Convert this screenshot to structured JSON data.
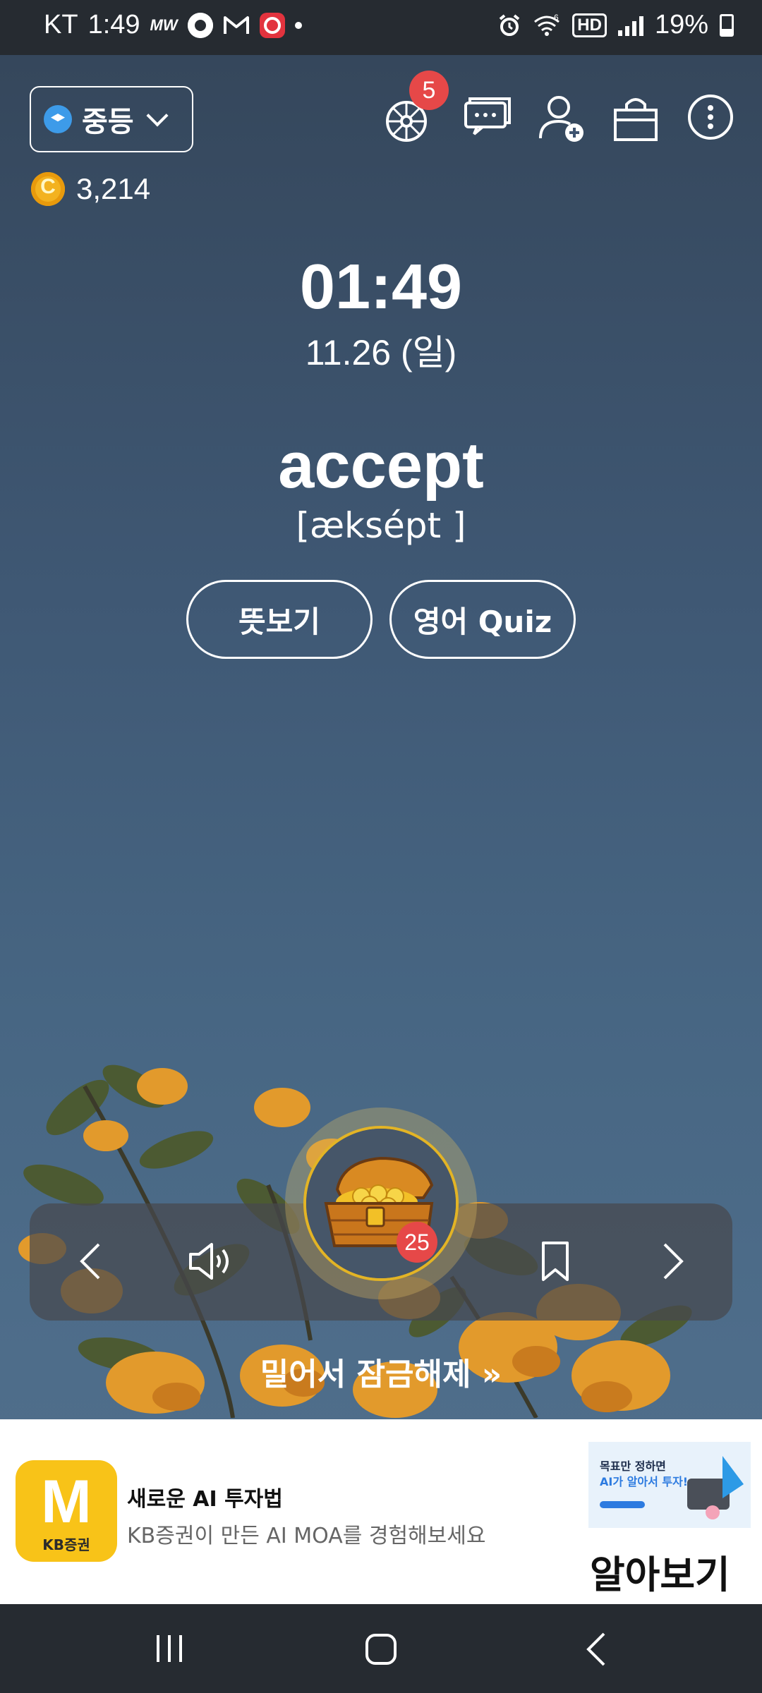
{
  "status_bar": {
    "carrier": "KT",
    "time": "1:49",
    "mini_label": "MW",
    "battery": "19%",
    "hd_label": "HD",
    "net_label": "6"
  },
  "header": {
    "grade": "중등",
    "notification_count": "5",
    "coins": "3,214"
  },
  "main": {
    "clock": "01:49",
    "date": "11.26 (일)",
    "word": "accept",
    "pronunciation": "[æksépt ]",
    "meaning_button": "뜻보기",
    "quiz_button": "영어 Quiz"
  },
  "player": {
    "chest_count": "25",
    "unlock_hint": "밀어서 잠금해제 »"
  },
  "ad": {
    "logo_letter": "M",
    "logo_brand": "KB증권",
    "title": "새로운 AI 투자법",
    "subtitle": "KB증권이 만든 AI MOA를 경험해보세요",
    "thumb_headline_1": "목표만 정하면",
    "thumb_headline_2": "AI가 알아서 투자!",
    "cta": "알아보기"
  },
  "colors": {
    "background_top": "#344559",
    "background_bottom": "#526f8a",
    "badge_red": "#e64848",
    "coin_gold": "#f3b21f",
    "ad_logo_yellow": "#f8c318"
  }
}
